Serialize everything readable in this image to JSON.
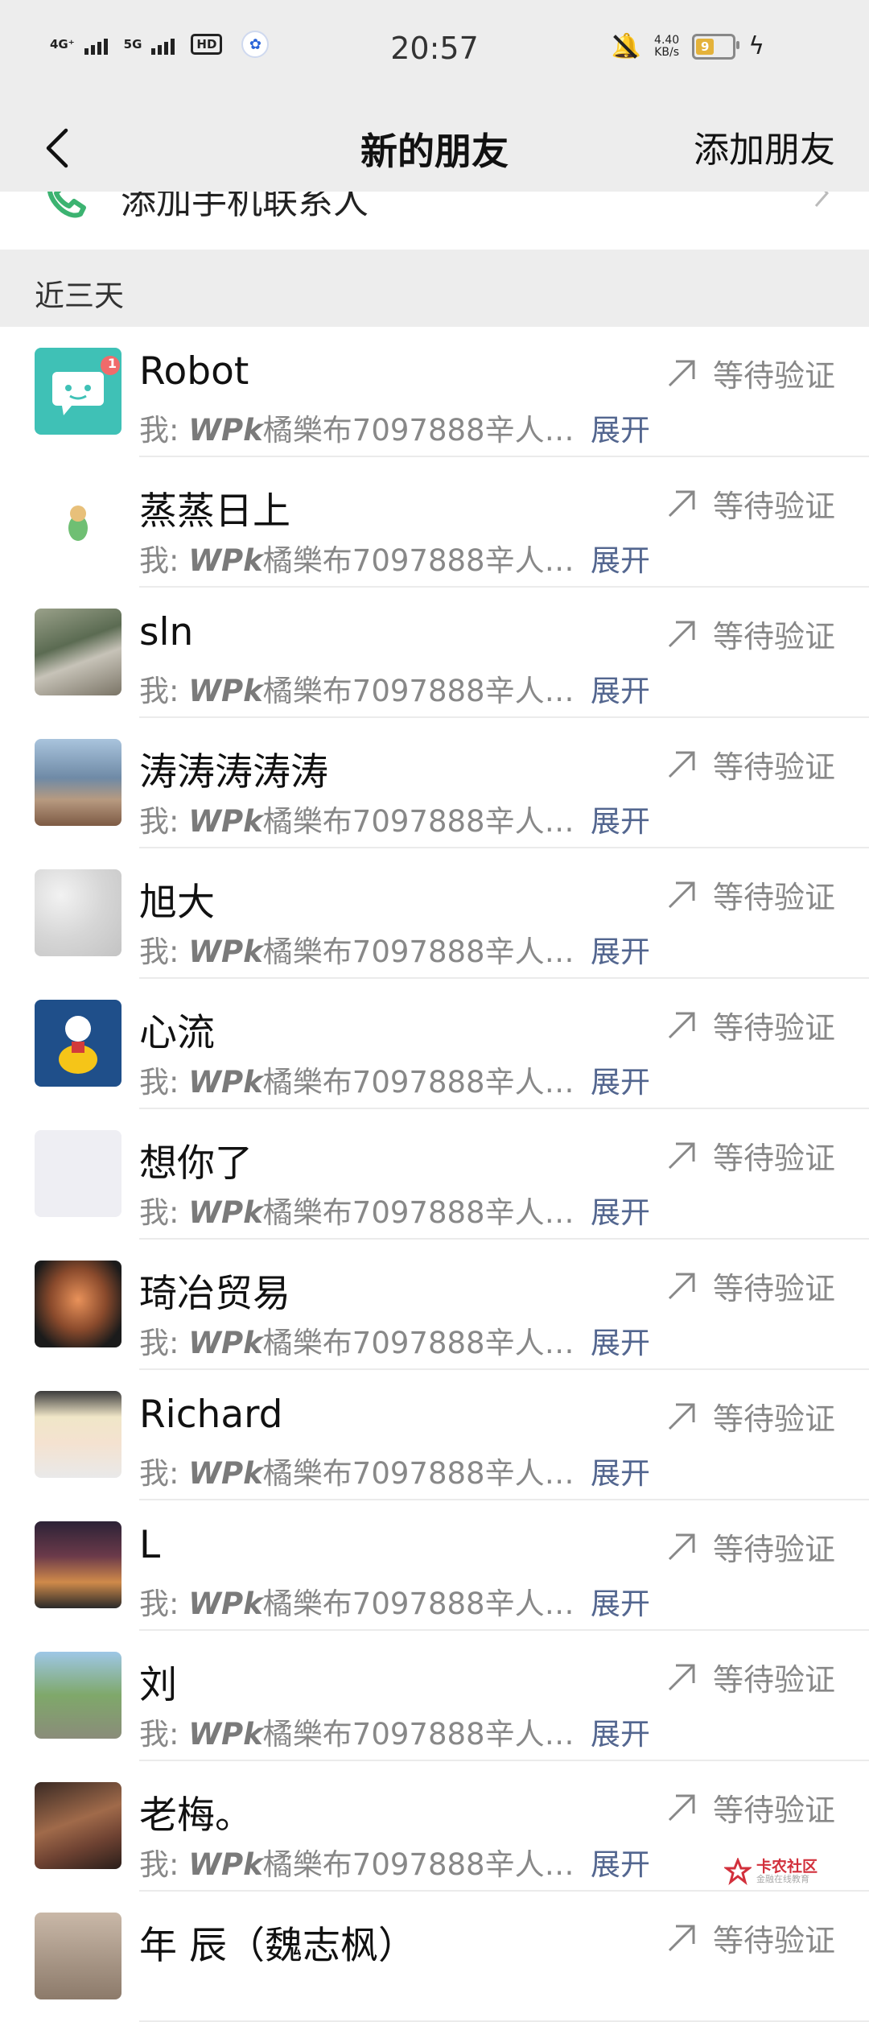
{
  "status_bar": {
    "signal1": "4G⁺",
    "signal2": "5G",
    "hd": "HD",
    "time": "20:57",
    "net_speed_value": "4.40",
    "net_speed_unit": "KB/s",
    "battery": "9"
  },
  "nav": {
    "title": "新的朋友",
    "action": "添加朋友"
  },
  "phone_contacts": {
    "label": "添加手机联系人"
  },
  "section": {
    "label": "近三天"
  },
  "requests": [
    {
      "name": "Robot",
      "msg_prefix": "我: ",
      "msg_bold": "WPk",
      "msg_rest": "橘樂布7097888辛人…",
      "expand": "展开",
      "status": "等待验证",
      "badge": "1"
    },
    {
      "name": "蒸蒸日上",
      "msg_prefix": "我: ",
      "msg_bold": "WPk",
      "msg_rest": "橘樂布7097888辛人…",
      "expand": "展开",
      "status": "等待验证"
    },
    {
      "name": "sln",
      "msg_prefix": "我: ",
      "msg_bold": "WPk",
      "msg_rest": "橘樂布7097888辛人…",
      "expand": "展开",
      "status": "等待验证"
    },
    {
      "name": "涛涛涛涛涛",
      "msg_prefix": "我: ",
      "msg_bold": "WPk",
      "msg_rest": "橘樂布7097888辛人…",
      "expand": "展开",
      "status": "等待验证"
    },
    {
      "name": "旭大",
      "msg_prefix": "我: ",
      "msg_bold": "WPk",
      "msg_rest": "橘樂布7097888辛人…",
      "expand": "展开",
      "status": "等待验证"
    },
    {
      "name": "心流",
      "msg_prefix": "我: ",
      "msg_bold": "WPk",
      "msg_rest": "橘樂布7097888辛人…",
      "expand": "展开",
      "status": "等待验证"
    },
    {
      "name": "想你了",
      "msg_prefix": "我: ",
      "msg_bold": "WPk",
      "msg_rest": "橘樂布7097888辛人…",
      "expand": "展开",
      "status": "等待验证"
    },
    {
      "name": "琦冶贸易",
      "msg_prefix": "我: ",
      "msg_bold": "WPk",
      "msg_rest": "橘樂布7097888辛人…",
      "expand": "展开",
      "status": "等待验证"
    },
    {
      "name": "Richard",
      "msg_prefix": "我: ",
      "msg_bold": "WPk",
      "msg_rest": "橘樂布7097888辛人…",
      "expand": "展开",
      "status": "等待验证"
    },
    {
      "name": "L",
      "msg_prefix": "我: ",
      "msg_bold": "WPk",
      "msg_rest": "橘樂布7097888辛人…",
      "expand": "展开",
      "status": "等待验证"
    },
    {
      "name": "刘",
      "msg_prefix": "我: ",
      "msg_bold": "WPk",
      "msg_rest": "橘樂布7097888辛人…",
      "expand": "展开",
      "status": "等待验证"
    },
    {
      "name": "老梅。",
      "msg_prefix": "我: ",
      "msg_bold": "WPk",
      "msg_rest": "橘樂布7097888辛人…",
      "expand": "展开",
      "status": "等待验证"
    },
    {
      "name": "年 辰（魏志枫）",
      "msg_prefix": "",
      "msg_bold": "",
      "msg_rest": "",
      "expand": "",
      "status": "等待验证"
    }
  ],
  "watermark": {
    "title": "卡农社区",
    "subtitle": "金融在线教育"
  },
  "colors": {
    "background": "#ededed",
    "link": "#53668f",
    "secondary_text": "#888888",
    "phone_icon": "#3cb371"
  }
}
